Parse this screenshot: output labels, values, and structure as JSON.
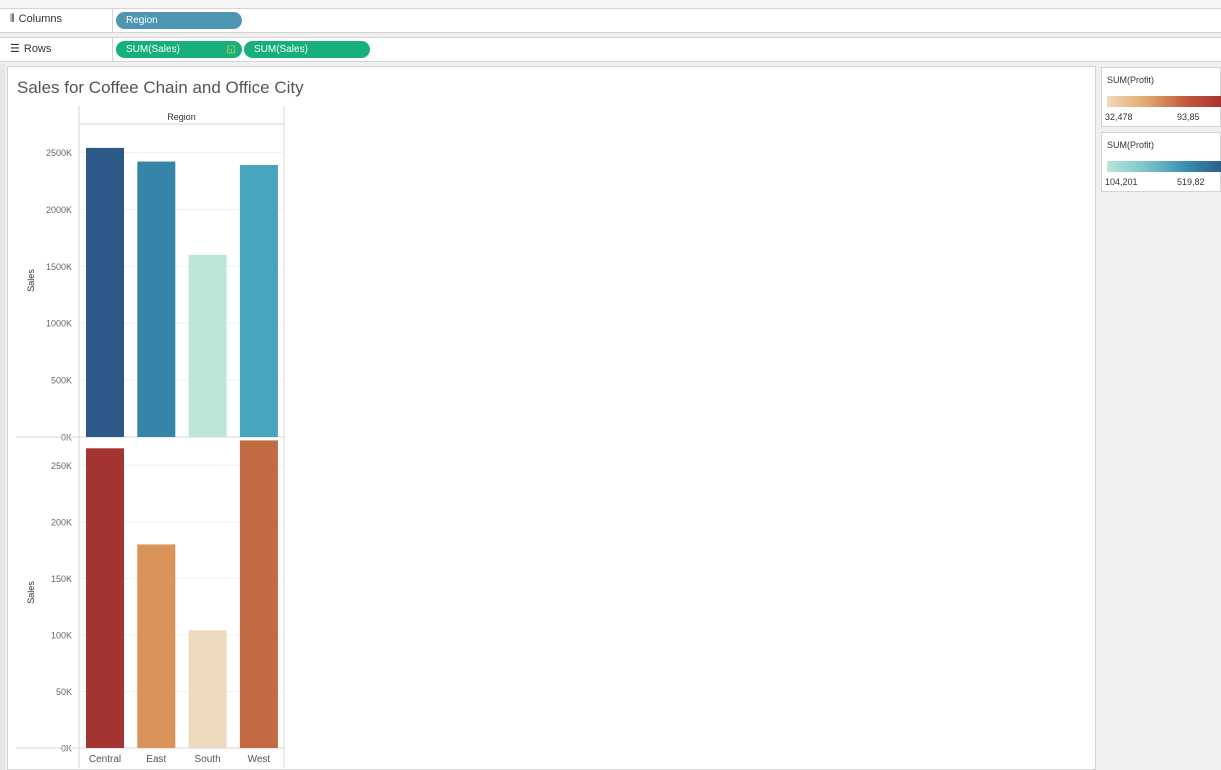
{
  "shelves": {
    "columns_label": "Columns",
    "rows_label": "Rows",
    "columns_pill": "Region",
    "rows_pills": [
      "SUM(Sales)",
      "SUM(Sales)"
    ]
  },
  "legends": [
    {
      "title": "SUM(Profit)",
      "min": "32,478",
      "max": "93,85",
      "colors": [
        "#f0d9b5",
        "#e0a870",
        "#c45a3c",
        "#a5302e"
      ]
    },
    {
      "title": "SUM(Profit)",
      "min": "104,201",
      "max": "519,82",
      "colors": [
        "#b9e5dc",
        "#7cc4c9",
        "#3a8fb0",
        "#2a5a85"
      ]
    }
  ],
  "chart_data": {
    "type": "bar",
    "title": "Sales for Coffee Chain and Office City",
    "column_header": "Region",
    "categories": [
      "Central",
      "East",
      "South",
      "West"
    ],
    "panes": [
      {
        "ylabel": "Sales",
        "ylim": [
          0,
          2750000
        ],
        "ticks": [
          0,
          500000,
          1000000,
          1500000,
          2000000,
          2500000
        ],
        "tick_labels": [
          "0K",
          "500K",
          "1000K",
          "1500K",
          "2000K",
          "2500K"
        ],
        "values": [
          2540000,
          2420000,
          1600000,
          2390000
        ],
        "colors": [
          "#2b5886",
          "#3585a9",
          "#bde5da",
          "#47a4bc"
        ]
      },
      {
        "ylabel": "Sales",
        "ylim": [
          0,
          275000
        ],
        "ticks": [
          0,
          50000,
          100000,
          150000,
          200000,
          250000
        ],
        "tick_labels": [
          "0K",
          "50K",
          "100K",
          "150K",
          "200K",
          "250K"
        ],
        "values": [
          265000,
          180000,
          104000,
          272000
        ],
        "colors": [
          "#a33432",
          "#d99258",
          "#edd9bb",
          "#c26a42"
        ]
      }
    ]
  }
}
